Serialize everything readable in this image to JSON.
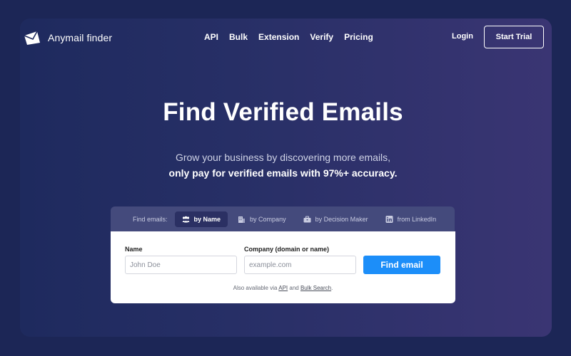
{
  "brand": {
    "name": "Anymail finder"
  },
  "nav": {
    "items": [
      {
        "label": "API"
      },
      {
        "label": "Bulk"
      },
      {
        "label": "Extension"
      },
      {
        "label": "Verify"
      },
      {
        "label": "Pricing"
      }
    ],
    "login_label": "Login",
    "trial_label": "Start Trial"
  },
  "hero": {
    "title": "Find Verified Emails",
    "subtitle_line1": "Grow your business by discovering more emails,",
    "subtitle_line2": "only pay for verified emails with 97%+ accuracy."
  },
  "search": {
    "tabs_label": "Find emails:",
    "tabs": [
      {
        "label": "by Name",
        "icon": "people-icon",
        "active": true
      },
      {
        "label": "by Company",
        "icon": "building-icon",
        "active": false
      },
      {
        "label": "by Decision Maker",
        "icon": "briefcase-icon",
        "active": false
      },
      {
        "label": "from LinkedIn",
        "icon": "linkedin-icon",
        "active": false
      }
    ],
    "name_label": "Name",
    "name_placeholder": "John Doe",
    "company_label": "Company (domain or name)",
    "company_placeholder": "example.com",
    "button_label": "Find email",
    "note_prefix": "Also available via",
    "note_link1": "API",
    "note_and": "and",
    "note_link2": "Bulk Search",
    "note_suffix": "."
  },
  "colors": {
    "background": "#1d2657",
    "accent": "#1c8ef9",
    "tab_bar": "#444a7c"
  }
}
